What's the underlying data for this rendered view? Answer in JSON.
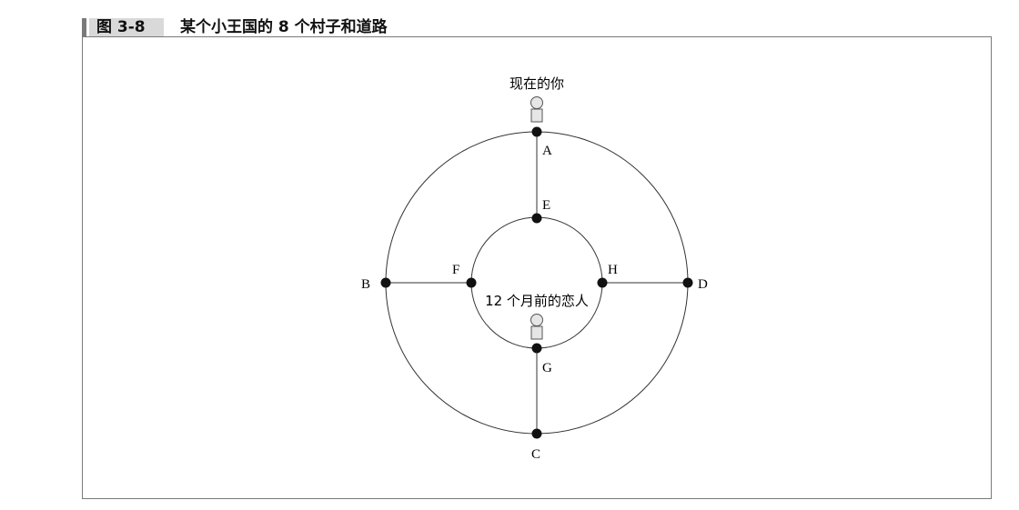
{
  "caption": {
    "tag": "图 3-8",
    "title": "某个小王国的 8 个村子和道路"
  },
  "diagram": {
    "villages": [
      "A",
      "B",
      "C",
      "D",
      "E",
      "F",
      "G",
      "H"
    ],
    "persons": {
      "you": "现在的你",
      "lover": "12 个月前的恋人"
    }
  }
}
